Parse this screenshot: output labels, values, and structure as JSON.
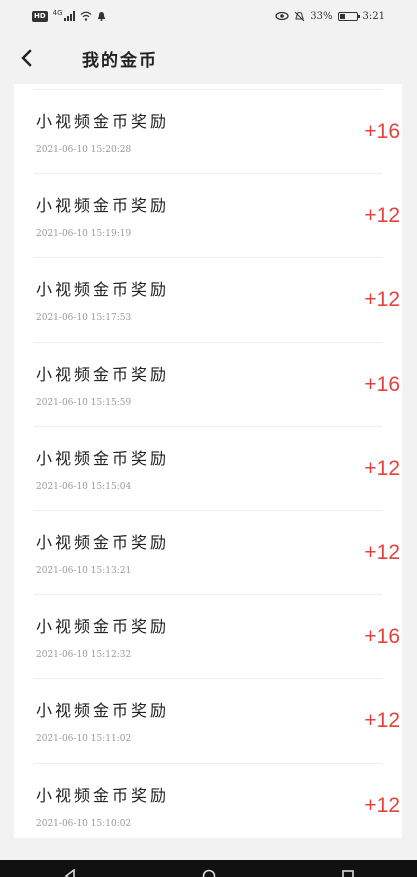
{
  "status_bar": {
    "hd": "HD",
    "network": "4G",
    "battery_percent": "33%",
    "time": "3:21"
  },
  "header": {
    "title": "我的金币"
  },
  "records": [
    {
      "title": "小视频金币奖励",
      "time": "2021-06-10 15:20:28",
      "amount": "+16"
    },
    {
      "title": "小视频金币奖励",
      "time": "2021-06-10 15:19:19",
      "amount": "+12"
    },
    {
      "title": "小视频金币奖励",
      "time": "2021-06-10 15:17:53",
      "amount": "+12"
    },
    {
      "title": "小视频金币奖励",
      "time": "2021-06-10 15:15:59",
      "amount": "+16"
    },
    {
      "title": "小视频金币奖励",
      "time": "2021-06-10 15:15:04",
      "amount": "+12"
    },
    {
      "title": "小视频金币奖励",
      "time": "2021-06-10 15:13:21",
      "amount": "+12"
    },
    {
      "title": "小视频金币奖励",
      "time": "2021-06-10 15:12:32",
      "amount": "+16"
    },
    {
      "title": "小视频金币奖励",
      "time": "2021-06-10 15:11:02",
      "amount": "+12"
    },
    {
      "title": "小视频金币奖励",
      "time": "2021-06-10 15:10:02",
      "amount": "+12"
    }
  ],
  "colors": {
    "amount": "#e8413b",
    "background": "#f2f2f2",
    "card": "#ffffff"
  },
  "icons": {
    "back": "chevron-left-icon",
    "nav_back": "triangle-back-icon",
    "nav_home": "circle-home-icon",
    "nav_recent": "square-recent-icon"
  }
}
